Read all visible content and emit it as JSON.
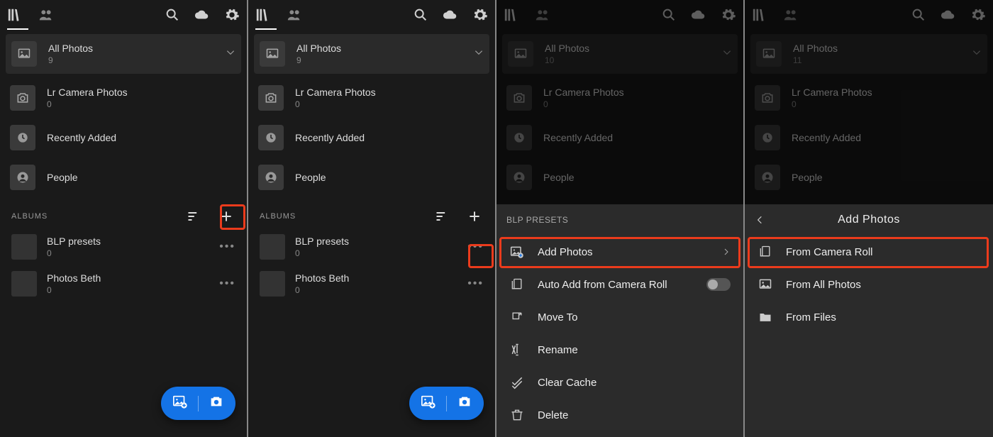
{
  "panels": [
    {
      "all_photos": "All Photos",
      "all_count": "9",
      "lr_cam": "Lr Camera Photos",
      "lr_count": "0",
      "recent": "Recently Added",
      "people": "People",
      "albums_label": "ALBUMS",
      "album1": "BLP presets",
      "album1_count": "0",
      "album2": "Photos Beth",
      "album2_count": "0"
    },
    {
      "all_photos": "All Photos",
      "all_count": "9",
      "lr_cam": "Lr Camera Photos",
      "lr_count": "0",
      "recent": "Recently Added",
      "people": "People",
      "albums_label": "ALBUMS",
      "album1": "BLP presets",
      "album1_count": "0",
      "album2": "Photos Beth",
      "album2_count": "0"
    },
    {
      "all_photos": "All Photos",
      "all_count": "10",
      "lr_cam": "Lr Camera Photos",
      "lr_count": "0",
      "recent": "Recently Added",
      "people": "People",
      "sheet_title": "BLP PRESETS",
      "menu": {
        "add_photos": "Add Photos",
        "auto_add": "Auto Add from Camera Roll",
        "move_to": "Move To",
        "rename": "Rename",
        "clear_cache": "Clear Cache",
        "delete": "Delete"
      }
    },
    {
      "all_photos": "All Photos",
      "all_count": "11",
      "lr_cam": "Lr Camera Photos",
      "lr_count": "0",
      "recent": "Recently Added",
      "people": "People",
      "sheet_title": "Add Photos",
      "menu": {
        "from_camera_roll": "From Camera Roll",
        "from_all_photos": "From All Photos",
        "from_files": "From Files"
      }
    }
  ]
}
